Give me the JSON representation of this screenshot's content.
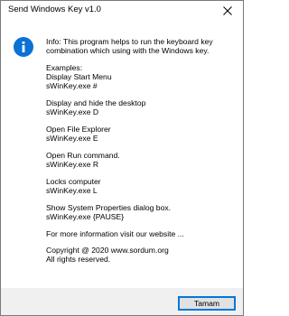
{
  "window": {
    "title": "Send Windows Key v1.0"
  },
  "icons": {
    "info": "info-icon",
    "close": "close-icon"
  },
  "colors": {
    "info_icon": "#0b71d4",
    "footer_bg": "#f0f0f0",
    "button_border": "#0078d7"
  },
  "message": {
    "intro_line1": "Info: This program helps to run the keyboard key",
    "intro_line2": "combination which using with the Windows key.",
    "examples_heading": "Examples:",
    "examples": [
      {
        "title": "Display Start Menu",
        "command": "sWinKey.exe #"
      },
      {
        "title": "Display and hide the desktop",
        "command": "sWinKey.exe D"
      },
      {
        "title": "Open File Explorer",
        "command": "sWinKey.exe E"
      },
      {
        "title": "Open Run command.",
        "command": "sWinKey.exe R"
      },
      {
        "title": "Locks computer",
        "command": "sWinKey.exe L"
      },
      {
        "title": "Show System Properties dialog box.",
        "command": "sWinKey.exe {PAUSE}"
      }
    ],
    "more_info": "For more information visit our website ...",
    "copyright": "Copyright @ 2020 www.sordum.org",
    "rights": "All rights reserved."
  },
  "footer": {
    "ok_label": "Tamam"
  }
}
